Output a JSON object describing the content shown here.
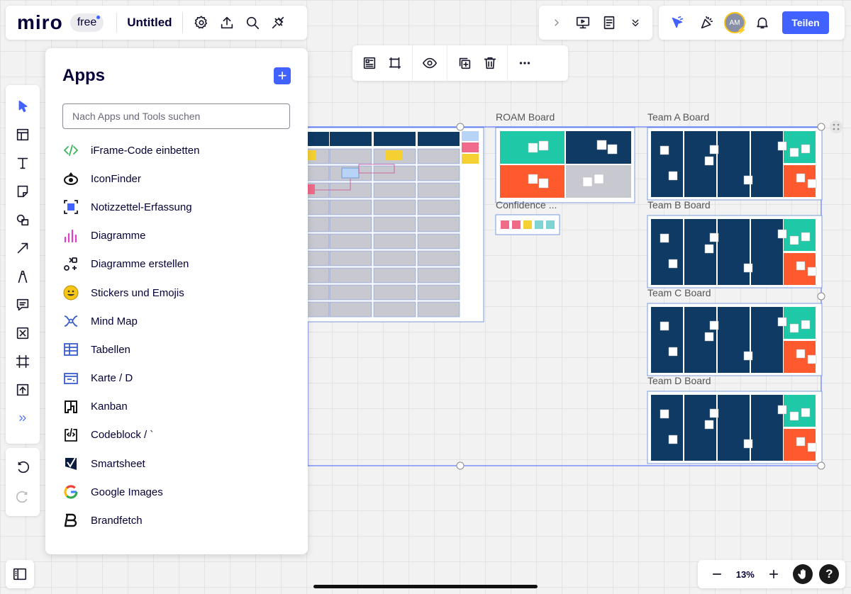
{
  "app": {
    "logo": "miro",
    "plan_badge": "free",
    "board_title": "Untitled"
  },
  "topbar": {
    "share_label": "Teilen",
    "avatar_initials": "AM"
  },
  "apps_panel": {
    "title": "Apps",
    "search_placeholder": "Nach Apps und Tools suchen",
    "items": [
      {
        "label": "iFrame-Code einbetten",
        "icon": "code-icon"
      },
      {
        "label": "IconFinder",
        "icon": "iconfinder-icon"
      },
      {
        "label": "Notizzettel-Erfassung",
        "icon": "sticky-capture-icon"
      },
      {
        "label": "Diagramme",
        "icon": "bar-chart-icon"
      },
      {
        "label": "Diagramme erstellen",
        "icon": "shapes-icon"
      },
      {
        "label": "Stickers und Emojis",
        "icon": "emoji-icon"
      },
      {
        "label": "Mind Map",
        "icon": "mind-map-icon"
      },
      {
        "label": "Tabellen",
        "icon": "table-icon"
      },
      {
        "label": "Karte / D",
        "icon": "card-icon"
      },
      {
        "label": "Kanban",
        "icon": "kanban-icon"
      },
      {
        "label": "Codeblock / `",
        "icon": "codeblock-icon"
      },
      {
        "label": "Smartsheet",
        "icon": "smartsheet-icon"
      },
      {
        "label": "Google Images",
        "icon": "google-icon"
      },
      {
        "label": "Brandfetch",
        "icon": "brandfetch-icon"
      }
    ]
  },
  "canvas": {
    "frames": [
      {
        "label": "ROAM Board"
      },
      {
        "label": "Confidence ..."
      },
      {
        "label": "Team A Board"
      },
      {
        "label": "Team B Board"
      },
      {
        "label": "Team C Board"
      },
      {
        "label": "Team D Board"
      }
    ]
  },
  "zoom": {
    "value": "13%"
  },
  "colors": {
    "accent": "#4262ff",
    "navy": "#0e3a63",
    "teal": "#1fc8a7",
    "orange": "#ff5a2e"
  }
}
